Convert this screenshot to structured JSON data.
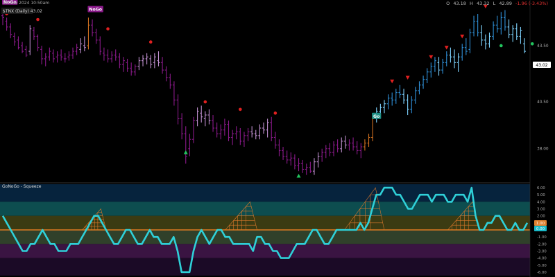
{
  "header": {
    "date": "25 Nov 2024 10:50am",
    "ohlc": {
      "o_label": "O",
      "o": "43.18",
      "h_label": "H",
      "h": "43.32",
      "l_label": "L",
      "l": "42.89",
      "change": "-1.96 (-3.43%)"
    }
  },
  "chart_data": [
    {
      "type": "ohlc",
      "title": "$TNX (Daily) 43.02",
      "price_label": "43.02",
      "y_ticks": [
        "43.50",
        "40.50",
        "38.00"
      ],
      "ylim": [
        36.4,
        45.2
      ],
      "colors": {
        "nogo_strong": "#8b1a8b",
        "nogo_weak": "#c090d0",
        "go_strong": "#2f8fd6",
        "go_weak": "#7fd4ff",
        "neutral": "#d07020"
      },
      "bars": [
        [
          45.1,
          45.5,
          44.6,
          45.0,
          "nogo_strong"
        ],
        [
          44.8,
          45.0,
          44.3,
          44.5,
          "nogo_strong"
        ],
        [
          44.5,
          44.7,
          43.9,
          44.1,
          "nogo_strong"
        ],
        [
          44.0,
          44.2,
          43.5,
          43.7,
          "nogo_strong"
        ],
        [
          43.8,
          44.0,
          43.3,
          43.4,
          "nogo_strong"
        ],
        [
          43.5,
          43.7,
          43.1,
          43.2,
          "nogo_strong"
        ],
        [
          43.3,
          43.5,
          42.9,
          43.0,
          "nogo_strong"
        ],
        [
          43.2,
          44.6,
          43.0,
          44.4,
          "nogo_weak"
        ],
        [
          44.3,
          44.5,
          43.8,
          44.0,
          "nogo_strong"
        ],
        [
          44.0,
          44.1,
          43.2,
          43.4,
          "nogo_strong"
        ],
        [
          43.3,
          43.5,
          42.5,
          42.8,
          "nogo_strong"
        ],
        [
          42.8,
          43.1,
          42.4,
          42.9,
          "nogo_strong"
        ],
        [
          42.9,
          43.4,
          42.7,
          43.2,
          "nogo_strong"
        ],
        [
          43.1,
          43.3,
          42.6,
          42.8,
          "nogo_strong"
        ],
        [
          42.9,
          43.2,
          42.6,
          43.0,
          "nogo_strong"
        ],
        [
          43.0,
          43.3,
          42.7,
          42.9,
          "nogo_strong"
        ],
        [
          42.8,
          43.1,
          42.6,
          42.8,
          "nogo_strong"
        ],
        [
          42.9,
          43.2,
          42.7,
          43.0,
          "nogo_strong"
        ],
        [
          43.0,
          43.4,
          42.8,
          43.2,
          "nogo_strong"
        ],
        [
          43.2,
          43.6,
          43.0,
          43.4,
          "nogo_strong"
        ],
        [
          43.3,
          43.9,
          43.1,
          43.6,
          "nogo_weak"
        ],
        [
          43.5,
          44.0,
          43.2,
          43.4,
          "nogo_weak"
        ],
        [
          43.5,
          45.0,
          43.3,
          44.6,
          "neutral"
        ],
        [
          44.6,
          44.9,
          44.0,
          44.2,
          "nogo_strong"
        ],
        [
          44.2,
          44.4,
          43.6,
          43.8,
          "nogo_strong"
        ],
        [
          43.8,
          44.0,
          43.0,
          43.2,
          "nogo_strong"
        ],
        [
          43.1,
          43.4,
          42.7,
          43.0,
          "nogo_strong"
        ],
        [
          43.0,
          43.3,
          42.6,
          42.8,
          "nogo_strong"
        ],
        [
          42.8,
          43.2,
          42.6,
          43.0,
          "nogo_strong"
        ],
        [
          43.0,
          43.3,
          42.7,
          42.9,
          "nogo_strong"
        ],
        [
          42.9,
          43.1,
          42.3,
          42.5,
          "nogo_strong"
        ],
        [
          42.5,
          42.9,
          42.1,
          42.7,
          "nogo_strong"
        ],
        [
          42.6,
          42.8,
          42.1,
          42.3,
          "nogo_strong"
        ],
        [
          42.3,
          42.6,
          41.9,
          42.1,
          "nogo_strong"
        ],
        [
          42.1,
          42.5,
          41.9,
          42.4,
          "nogo_strong"
        ],
        [
          42.4,
          42.9,
          42.2,
          42.7,
          "nogo_weak"
        ],
        [
          42.7,
          43.0,
          42.4,
          42.8,
          "nogo_weak"
        ],
        [
          42.8,
          43.1,
          42.5,
          42.9,
          "nogo_weak"
        ],
        [
          42.8,
          43.0,
          42.3,
          42.5,
          "nogo_weak"
        ],
        [
          42.6,
          43.1,
          42.3,
          42.9,
          "nogo_weak"
        ],
        [
          42.7,
          43.2,
          42.4,
          42.6,
          "nogo_weak"
        ],
        [
          42.6,
          42.9,
          42.0,
          42.2,
          "nogo_strong"
        ],
        [
          42.2,
          42.4,
          41.6,
          41.8,
          "nogo_strong"
        ],
        [
          41.8,
          42.0,
          41.2,
          41.4,
          "nogo_strong"
        ],
        [
          41.4,
          41.6,
          40.3,
          40.6,
          "nogo_strong"
        ],
        [
          40.6,
          40.9,
          39.3,
          39.6,
          "nogo_strong"
        ],
        [
          39.6,
          39.9,
          38.5,
          38.8,
          "nogo_strong"
        ],
        [
          38.8,
          39.2,
          37.2,
          37.6,
          "nogo_strong"
        ],
        [
          38.0,
          38.8,
          37.6,
          38.5,
          "nogo_strong"
        ],
        [
          38.5,
          39.7,
          38.3,
          39.5,
          "nogo_strong"
        ],
        [
          39.5,
          40.2,
          39.2,
          40.0,
          "nogo_weak"
        ],
        [
          39.9,
          40.3,
          39.4,
          39.7,
          "nogo_weak"
        ],
        [
          39.6,
          40.0,
          39.2,
          39.8,
          "nogo_weak"
        ],
        [
          39.8,
          40.1,
          39.3,
          39.5,
          "nogo_weak"
        ],
        [
          39.5,
          39.8,
          38.9,
          39.1,
          "nogo_strong"
        ],
        [
          39.1,
          39.4,
          38.6,
          38.8,
          "nogo_strong"
        ],
        [
          38.8,
          39.3,
          38.5,
          39.0,
          "nogo_strong"
        ],
        [
          39.0,
          39.6,
          38.7,
          39.3,
          "nogo_strong"
        ],
        [
          39.3,
          39.5,
          38.4,
          38.6,
          "nogo_strong"
        ],
        [
          38.6,
          39.0,
          38.2,
          38.8,
          "nogo_strong"
        ],
        [
          38.8,
          39.2,
          38.5,
          38.9,
          "nogo_strong"
        ],
        [
          38.9,
          39.1,
          38.2,
          38.4,
          "nogo_strong"
        ],
        [
          38.4,
          38.9,
          38.1,
          38.7,
          "nogo_strong"
        ],
        [
          38.7,
          39.1,
          38.4,
          38.9,
          "nogo_strong"
        ],
        [
          38.9,
          39.2,
          38.6,
          38.8,
          "nogo_weak"
        ],
        [
          38.8,
          39.0,
          38.5,
          38.7,
          "nogo_weak"
        ],
        [
          38.7,
          39.3,
          38.5,
          39.1,
          "nogo_weak"
        ],
        [
          39.1,
          39.4,
          38.8,
          39.0,
          "nogo_weak"
        ],
        [
          39.0,
          39.6,
          38.6,
          39.4,
          "nogo_weak"
        ],
        [
          39.4,
          39.7,
          38.4,
          38.6,
          "nogo_strong"
        ],
        [
          38.6,
          38.9,
          38.0,
          38.2,
          "nogo_strong"
        ],
        [
          38.2,
          38.5,
          37.6,
          37.9,
          "nogo_strong"
        ],
        [
          37.9,
          38.1,
          37.4,
          37.6,
          "nogo_strong"
        ],
        [
          37.6,
          37.9,
          37.2,
          37.4,
          "nogo_strong"
        ],
        [
          37.4,
          37.8,
          37.1,
          37.5,
          "nogo_strong"
        ],
        [
          37.5,
          37.7,
          36.9,
          37.1,
          "nogo_strong"
        ],
        [
          37.1,
          37.5,
          36.8,
          37.2,
          "nogo_strong"
        ],
        [
          37.2,
          37.4,
          36.7,
          36.9,
          "nogo_strong"
        ],
        [
          36.9,
          37.2,
          36.6,
          37.0,
          "nogo_strong"
        ],
        [
          37.0,
          37.3,
          36.7,
          36.8,
          "nogo_strong"
        ],
        [
          36.8,
          37.5,
          36.6,
          37.3,
          "nogo_weak"
        ],
        [
          37.3,
          37.8,
          37.0,
          37.6,
          "nogo_weak"
        ],
        [
          37.6,
          38.0,
          37.3,
          37.8,
          "nogo_strong"
        ],
        [
          37.8,
          38.2,
          37.5,
          38.0,
          "nogo_strong"
        ],
        [
          38.0,
          38.3,
          37.6,
          37.8,
          "nogo_strong"
        ],
        [
          37.8,
          38.4,
          37.6,
          38.2,
          "nogo_strong"
        ],
        [
          38.2,
          38.5,
          37.8,
          38.0,
          "nogo_strong"
        ],
        [
          38.0,
          38.6,
          37.8,
          38.4,
          "nogo_weak"
        ],
        [
          38.4,
          38.7,
          38.0,
          38.2,
          "nogo_weak"
        ],
        [
          38.2,
          38.5,
          37.9,
          38.3,
          "nogo_strong"
        ],
        [
          38.3,
          38.6,
          37.9,
          38.1,
          "nogo_strong"
        ],
        [
          38.1,
          38.4,
          37.7,
          37.9,
          "nogo_strong"
        ],
        [
          37.9,
          38.3,
          37.5,
          38.1,
          "nogo_strong"
        ],
        [
          38.1,
          38.5,
          37.9,
          38.3,
          "neutral"
        ],
        [
          38.3,
          38.8,
          38.1,
          38.6,
          "neutral"
        ],
        [
          38.6,
          39.8,
          38.4,
          39.6,
          "neutral"
        ],
        [
          39.6,
          40.2,
          39.4,
          40.0,
          "go_weak"
        ],
        [
          40.0,
          40.4,
          39.8,
          40.2,
          "go_weak"
        ],
        [
          40.2,
          40.6,
          39.9,
          40.4,
          "go_weak"
        ],
        [
          40.4,
          40.9,
          40.1,
          40.7,
          "go_strong"
        ],
        [
          40.7,
          41.0,
          40.3,
          40.6,
          "go_strong"
        ],
        [
          40.6,
          41.2,
          40.4,
          41.0,
          "go_strong"
        ],
        [
          41.0,
          41.4,
          40.7,
          40.9,
          "go_strong"
        ],
        [
          40.9,
          41.2,
          40.4,
          40.6,
          "go_weak"
        ],
        [
          40.6,
          40.9,
          39.8,
          40.1,
          "go_weak"
        ],
        [
          40.1,
          40.8,
          39.9,
          40.6,
          "go_strong"
        ],
        [
          40.6,
          41.3,
          40.4,
          41.1,
          "go_strong"
        ],
        [
          41.1,
          41.6,
          40.9,
          41.4,
          "go_strong"
        ],
        [
          41.4,
          41.9,
          41.2,
          41.7,
          "go_strong"
        ],
        [
          41.7,
          42.3,
          41.5,
          42.1,
          "go_strong"
        ],
        [
          42.1,
          42.6,
          41.8,
          42.4,
          "go_strong"
        ],
        [
          42.4,
          42.9,
          42.1,
          42.7,
          "go_strong"
        ],
        [
          42.6,
          42.9,
          41.9,
          42.2,
          "go_weak"
        ],
        [
          42.2,
          42.8,
          42.0,
          42.6,
          "go_strong"
        ],
        [
          42.6,
          43.2,
          42.4,
          43.0,
          "go_strong"
        ],
        [
          43.0,
          43.4,
          42.6,
          42.9,
          "go_weak"
        ],
        [
          42.9,
          43.3,
          42.3,
          42.6,
          "go_weak"
        ],
        [
          42.6,
          43.1,
          42.1,
          42.9,
          "go_weak"
        ],
        [
          42.9,
          43.6,
          42.7,
          43.4,
          "go_strong"
        ],
        [
          43.4,
          43.9,
          43.0,
          43.2,
          "go_strong"
        ],
        [
          43.3,
          44.4,
          43.1,
          44.2,
          "go_strong"
        ],
        [
          44.2,
          45.1,
          44.0,
          44.8,
          "go_strong"
        ],
        [
          44.8,
          45.2,
          44.0,
          44.2,
          "go_strong"
        ],
        [
          44.2,
          44.6,
          43.5,
          43.8,
          "go_weak"
        ],
        [
          43.8,
          44.1,
          43.3,
          43.6,
          "go_weak"
        ],
        [
          43.6,
          44.2,
          43.4,
          44.0,
          "go_weak"
        ],
        [
          44.0,
          44.8,
          43.8,
          44.6,
          "go_strong"
        ],
        [
          44.6,
          45.1,
          44.2,
          44.4,
          "go_strong"
        ],
        [
          44.4,
          45.3,
          44.1,
          45.0,
          "go_strong"
        ],
        [
          45.0,
          45.4,
          44.3,
          44.5,
          "go_strong"
        ],
        [
          44.5,
          44.9,
          43.9,
          44.1,
          "go_weak"
        ],
        [
          44.1,
          44.6,
          43.7,
          44.4,
          "go_weak"
        ],
        [
          44.4,
          44.7,
          43.8,
          44.0,
          "go_weak"
        ],
        [
          44.0,
          44.5,
          43.6,
          44.3,
          "go_weak"
        ],
        [
          43.6,
          43.9,
          43.1,
          43.2,
          "go_weak"
        ]
      ],
      "reversal_dots": [
        {
          "i": 1,
          "v": 45.2
        },
        {
          "i": 9,
          "v": 44.9
        },
        {
          "i": 27,
          "v": 44.4
        },
        {
          "i": 38,
          "v": 43.7
        },
        {
          "i": 52,
          "v": 40.5
        },
        {
          "i": 61,
          "v": 40.1
        },
        {
          "i": 70,
          "v": 39.9
        },
        {
          "i": 128,
          "v": 43.5
        },
        {
          "i": 136,
          "v": 43.6
        }
      ],
      "reversal_triangles": [
        {
          "i": 47,
          "v": 37.8,
          "dir": "up",
          "color": "#22c55e"
        },
        {
          "i": 76,
          "v": 36.55,
          "dir": "up",
          "color": "#22c55e"
        },
        {
          "i": 100,
          "v": 41.6,
          "dir": "down",
          "color": "#e02020"
        },
        {
          "i": 104,
          "v": 41.8,
          "dir": "down",
          "color": "#e02020"
        },
        {
          "i": 110,
          "v": 42.9,
          "dir": "down",
          "color": "#e02020"
        },
        {
          "i": 114,
          "v": 43.4,
          "dir": "down",
          "color": "#e02020"
        },
        {
          "i": 118,
          "v": 44.0,
          "dir": "down",
          "color": "#e02020"
        },
        {
          "i": 124,
          "v": 45.6,
          "dir": "down",
          "color": "#e02020"
        }
      ],
      "badges": [
        {
          "text": "NoGo",
          "i": 0,
          "v": 45.8,
          "color": "#8b1a8b"
        },
        {
          "text": "NoGo",
          "i": 22,
          "v": 45.4,
          "color": "#8b1a8b"
        },
        {
          "text": "Go",
          "i": 95,
          "v": 39.7,
          "color": "#1f8f85"
        }
      ]
    },
    {
      "type": "line",
      "title": "GoNoGo - Squeeze",
      "ylim": [
        -6.5,
        6.5
      ],
      "y_ticks": [
        "6.00",
        "5.00",
        "4.00",
        "3.00",
        "2.00",
        "1.00",
        "-1.00",
        "-2.00",
        "-3.00",
        "-4.00",
        "-5.00",
        "-6.00"
      ],
      "markers": [
        "1.00",
        "0.00"
      ],
      "values": [
        2,
        1,
        0,
        -1,
        -2,
        -3,
        -3,
        -2,
        -2,
        -1,
        0,
        -1,
        -2,
        -2,
        -3,
        -3,
        -3,
        -2,
        -2,
        -2,
        -1,
        0,
        1,
        2,
        2,
        1,
        0,
        -1,
        -2,
        -2,
        -1,
        0,
        0,
        -1,
        -2,
        -2,
        -1,
        0,
        -1,
        -1,
        -2,
        -2,
        -2,
        -1,
        -3,
        -6,
        -6,
        -6,
        -3,
        -1,
        0,
        -1,
        -2,
        -1,
        0,
        0,
        -1,
        -1,
        -2,
        -2,
        -2,
        -2,
        -2,
        -3,
        -1,
        -1,
        -2,
        -2,
        -3,
        -3,
        -4,
        -4,
        -4,
        -3,
        -2,
        -2,
        -2,
        -1,
        0,
        0,
        -1,
        -2,
        -2,
        -1,
        0,
        0,
        0,
        0,
        0,
        0,
        1,
        0,
        1,
        3,
        5,
        5,
        6,
        6,
        6,
        5,
        5,
        4,
        3,
        3,
        4,
        5,
        5,
        5,
        4,
        5,
        5,
        5,
        4,
        4,
        5,
        5,
        5,
        4,
        6,
        2,
        0,
        0,
        1,
        1,
        2,
        2,
        1,
        0,
        0,
        1,
        0,
        0,
        1
      ],
      "squeeze": [
        {
          "start": 20,
          "end": 26,
          "max": 3
        },
        {
          "start": 56,
          "end": 64,
          "max": 4
        },
        {
          "start": 86,
          "end": 96,
          "max": 6
        },
        {
          "start": 112,
          "end": 120,
          "max": 4
        }
      ]
    }
  ]
}
